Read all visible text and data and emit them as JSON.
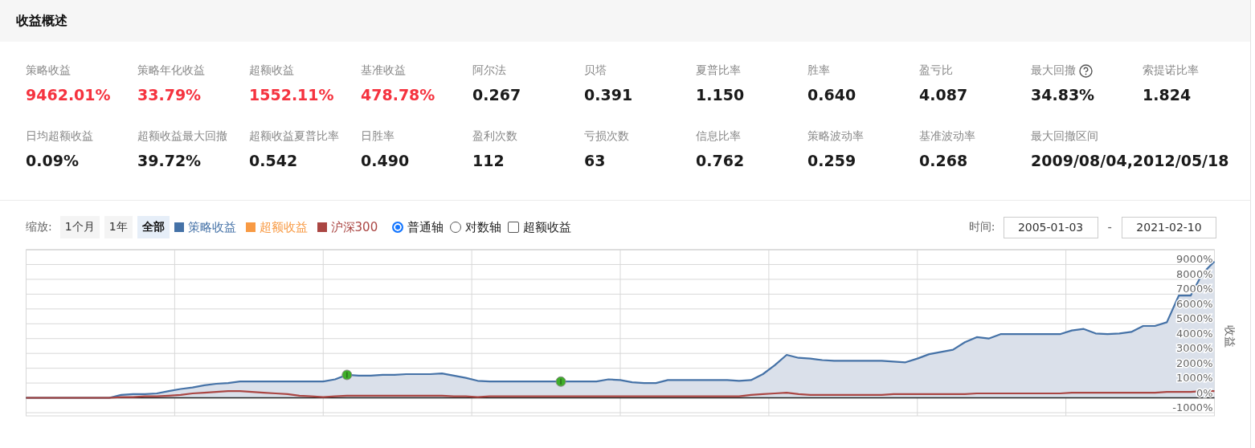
{
  "panel": {
    "title": "收益概述"
  },
  "metrics": [
    {
      "label": "策略收益",
      "value": "9462.01%",
      "color": "#f5333f"
    },
    {
      "label": "策略年化收益",
      "value": "33.79%",
      "color": "#f5333f"
    },
    {
      "label": "超额收益",
      "value": "1552.11%",
      "color": "#f5333f"
    },
    {
      "label": "基准收益",
      "value": "478.78%",
      "color": "#f5333f"
    },
    {
      "label": "阿尔法",
      "value": "0.267",
      "color": "#1a1a1a"
    },
    {
      "label": "贝塔",
      "value": "0.391",
      "color": "#1a1a1a"
    },
    {
      "label": "夏普比率",
      "value": "1.150",
      "color": "#1a1a1a"
    },
    {
      "label": "胜率",
      "value": "0.640",
      "color": "#1a1a1a"
    },
    {
      "label": "盈亏比",
      "value": "4.087",
      "color": "#1a1a1a"
    },
    {
      "label": "最大回撤",
      "value": "34.83%",
      "color": "#1a1a1a",
      "help": true
    },
    {
      "label": "索提诺比率",
      "value": "1.824",
      "color": "#1a1a1a"
    },
    {
      "label": "日均超额收益",
      "value": "0.09%",
      "color": "#1a1a1a"
    },
    {
      "label": "超额收益最大回撤",
      "value": "39.72%",
      "color": "#1a1a1a"
    },
    {
      "label": "超额收益夏普比率",
      "value": "0.542",
      "color": "#1a1a1a"
    },
    {
      "label": "日胜率",
      "value": "0.490",
      "color": "#1a1a1a"
    },
    {
      "label": "盈利次数",
      "value": "112",
      "color": "#1a1a1a"
    },
    {
      "label": "亏损次数",
      "value": "63",
      "color": "#1a1a1a"
    },
    {
      "label": "信息比率",
      "value": "0.762",
      "color": "#1a1a1a"
    },
    {
      "label": "策略波动率",
      "value": "0.259",
      "color": "#1a1a1a"
    },
    {
      "label": "基准波动率",
      "value": "0.268",
      "color": "#1a1a1a"
    },
    {
      "label": "最大回撤区间",
      "value": "2009/08/04,2012/05/18",
      "color": "#1a1a1a"
    }
  ],
  "toolbar": {
    "zoom_label": "缩放:",
    "zoom_buttons": [
      {
        "label": "1个月",
        "selected": false
      },
      {
        "label": "1年",
        "selected": false
      },
      {
        "label": "全部",
        "selected": true
      }
    ],
    "legend": [
      {
        "kind": "series"
      },
      {
        "kind": "extra",
        "label": "超额收益",
        "color": "#f89a44"
      },
      {
        "kind": "series"
      }
    ],
    "axis_options": [
      {
        "label": "普通轴",
        "selected": true
      },
      {
        "label": "对数轴",
        "selected": false
      }
    ],
    "excess_toggle": {
      "label": "超额收益",
      "checked": false
    },
    "time_label": "时间:",
    "start_date": "2005-01-03",
    "separator": "-",
    "end_date": "2021-02-10"
  },
  "chart": {
    "chart_data": {
      "type": "area",
      "ylabel": "收益",
      "ylim": [
        -1000,
        10000
      ],
      "yticks": [
        {
          "value": -1000,
          "label": "-1000%"
        },
        {
          "value": 0,
          "label": "0%"
        },
        {
          "value": 1000,
          "label": "1000%"
        },
        {
          "value": 2000,
          "label": "2000%"
        },
        {
          "value": 3000,
          "label": "3000%"
        },
        {
          "value": 4000,
          "label": "4000%"
        },
        {
          "value": 5000,
          "label": "5000%"
        },
        {
          "value": 6000,
          "label": "6000%"
        },
        {
          "value": 7000,
          "label": "7000%"
        },
        {
          "value": 8000,
          "label": "8000%"
        },
        {
          "value": 9000,
          "label": "9000%"
        }
      ],
      "categories": [
        null,
        null,
        null,
        null,
        null,
        null,
        null,
        null,
        null,
        null,
        null,
        null,
        null,
        null,
        null,
        null,
        null,
        null,
        null,
        null,
        null,
        null,
        null,
        null,
        null,
        null,
        null,
        null,
        null,
        null,
        null,
        null,
        null,
        null,
        null,
        null,
        null,
        null,
        null,
        null,
        null,
        null,
        null,
        null,
        null,
        null,
        null,
        null,
        null,
        null,
        null,
        null,
        null,
        null,
        null,
        null,
        null,
        null,
        null,
        null,
        null,
        null,
        null,
        null,
        null,
        null,
        null,
        null,
        null,
        null,
        null,
        null,
        null,
        null,
        null,
        null,
        null,
        null,
        null,
        null,
        null,
        null,
        null,
        null,
        null,
        null,
        null,
        null,
        null,
        null,
        null,
        null,
        null,
        null,
        null,
        null,
        null,
        null,
        null,
        null,
        null
      ],
      "series": [
        {
          "name": "策略收益",
          "color": "#4572a7",
          "values": [
            0,
            0,
            0,
            0,
            0,
            0,
            0,
            0,
            200,
            250,
            250,
            300,
            450,
            600,
            700,
            850,
            950,
            1000,
            1100,
            1100,
            1100,
            1100,
            1100,
            1100,
            1100,
            1100,
            1250,
            1550,
            1500,
            1500,
            1550,
            1550,
            1600,
            1600,
            1600,
            1650,
            1500,
            1350,
            1150,
            1100,
            1100,
            1100,
            1100,
            1100,
            1100,
            1100,
            1100,
            1100,
            1100,
            1250,
            1200,
            1050,
            1000,
            1000,
            1200,
            1200,
            1200,
            1200,
            1200,
            1200,
            1150,
            1200,
            1600,
            2200,
            2900,
            2700,
            2650,
            2550,
            2500,
            2500,
            2500,
            2500,
            2500,
            2450,
            2400,
            2650,
            2950,
            3100,
            3250,
            3750,
            4100,
            4000,
            4300,
            4300,
            4300,
            4300,
            4300,
            4300,
            4550,
            4650,
            4350,
            4300,
            4350,
            4450,
            4850,
            4850,
            5100,
            6900,
            6900,
            8400,
            9200
          ]
        },
        {
          "name": "沪深300",
          "type": "line",
          "color": "#aa4643",
          "values": [
            0,
            0,
            0,
            0,
            0,
            0,
            0,
            0,
            50,
            50,
            100,
            100,
            150,
            200,
            300,
            350,
            400,
            450,
            450,
            400,
            350,
            300,
            250,
            150,
            100,
            50,
            100,
            150,
            150,
            150,
            150,
            150,
            150,
            150,
            150,
            150,
            100,
            100,
            50,
            100,
            100,
            100,
            100,
            100,
            100,
            100,
            100,
            100,
            100,
            100,
            100,
            100,
            100,
            100,
            100,
            100,
            100,
            100,
            100,
            100,
            100,
            200,
            250,
            300,
            350,
            250,
            200,
            200,
            200,
            200,
            200,
            200,
            200,
            250,
            250,
            250,
            250,
            250,
            250,
            250,
            300,
            300,
            300,
            300,
            300,
            300,
            300,
            300,
            350,
            350,
            350,
            350,
            350,
            350,
            350,
            350,
            400,
            400,
            400,
            450,
            450
          ]
        },
        {
          "type": "scatter",
          "color": "#3fae2a",
          "values": [
            null,
            null,
            null,
            null,
            null,
            null,
            null,
            null,
            null,
            null,
            null,
            null,
            null,
            null,
            null,
            null,
            null,
            null,
            null,
            null,
            null,
            null,
            null,
            null,
            null,
            null,
            null,
            1550,
            null,
            null,
            null,
            null,
            null,
            null,
            null,
            null,
            null,
            null,
            null,
            null,
            null,
            null,
            null,
            null,
            null,
            1100,
            null,
            null,
            null,
            null,
            null,
            null,
            null,
            null,
            null,
            null,
            null,
            null,
            null,
            null,
            null,
            null,
            null,
            null,
            null,
            null,
            null,
            null,
            null,
            null,
            null,
            null,
            null,
            null,
            null,
            null,
            null,
            null,
            null,
            null,
            null,
            null,
            null,
            null,
            null,
            null,
            null,
            null,
            null,
            null,
            null,
            null,
            null,
            null,
            null,
            null,
            null,
            null,
            null,
            null,
            null
          ]
        }
      ],
      "grid": true
    }
  }
}
